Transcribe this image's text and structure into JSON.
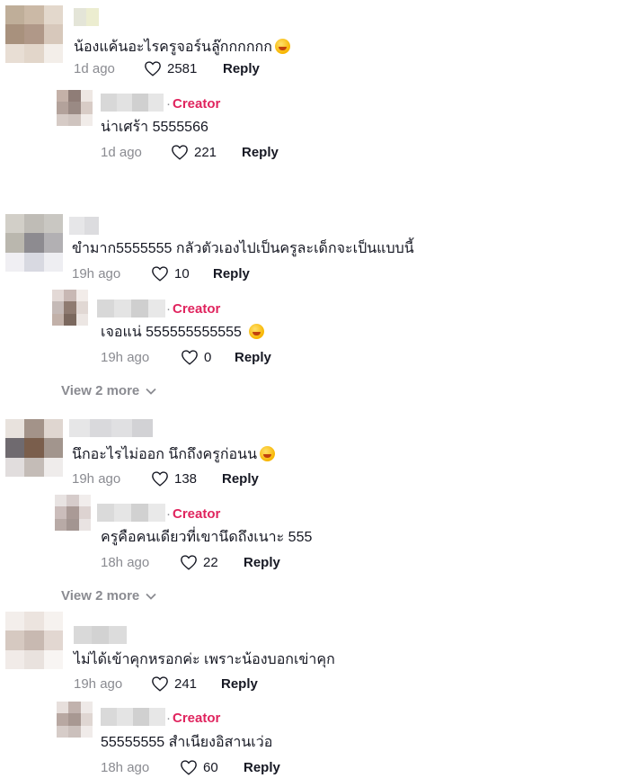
{
  "threads": [
    {
      "comment": {
        "text": "น้องแค้นอะไรครูจอร์นลู๊กกกกกก",
        "emoji": "rolling-laughing-emoji",
        "time": "1d ago",
        "likes": "2581",
        "reply": "Reply"
      },
      "creator_reply": {
        "badge": "Creator",
        "text": "น่าเศร้า 5555566",
        "time": "1d ago",
        "likes": "221",
        "reply": "Reply"
      }
    },
    {
      "comment": {
        "text": "ขำมาก5555555 กลัวตัวเองไปเป็นครูละเด็กจะเป็นแบบนี้",
        "time": "19h ago",
        "likes": "10",
        "reply": "Reply"
      },
      "creator_reply": {
        "badge": "Creator",
        "text": "เจอแน่ 555555555555",
        "emoji": "laughing-emoji",
        "time": "19h ago",
        "likes": "0",
        "reply": "Reply"
      },
      "view_more": "View 2 more"
    },
    {
      "comment": {
        "text": "นึกอะไรไม่ออก นึกถึงครูก่อนน",
        "emoji": "tears-of-joy-emoji",
        "time": "19h ago",
        "likes": "138",
        "reply": "Reply"
      },
      "creator_reply": {
        "badge": "Creator",
        "text": "ครูคือคนเดียวที่เขานึดถึงเนาะ 555",
        "time": "18h ago",
        "likes": "22",
        "reply": "Reply"
      },
      "view_more": "View 2 more"
    },
    {
      "comment": {
        "text": "ไม่ได้เข้าคุกหรอกค่ะ เพราะน้องบอกเข่าคุก",
        "time": "19h ago",
        "likes": "241",
        "reply": "Reply"
      },
      "creator_reply": {
        "badge": "Creator",
        "text": "55555555 สำเนียงอิสานเว่อ",
        "time": "18h ago",
        "likes": "60",
        "reply": "Reply"
      }
    }
  ]
}
